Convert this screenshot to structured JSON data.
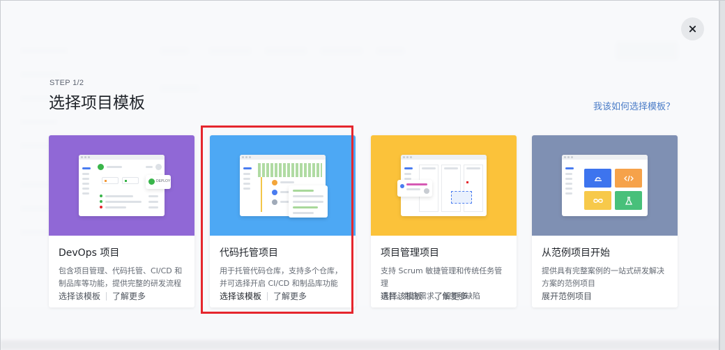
{
  "modal": {
    "step": "STEP 1/2",
    "title": "选择项目模板",
    "help_link": "我该如何选择模板？"
  },
  "colors": {
    "devops": "#9068d6",
    "code": "#4da8f4",
    "pm": "#fbc23a",
    "sample": "#7f90b3",
    "highlight": "#e5262d"
  },
  "cards": [
    {
      "title": "DevOps 项目",
      "desc_line1": "包含项目管理、代码托管、CI/CD 和",
      "desc_line2": "制品库等功能，提供完整的研发流程",
      "action1": "选择该模板",
      "action2": "了解更多",
      "badge": "DEPLOY"
    },
    {
      "title": "代码托管项目",
      "desc_line1": "用于托管代码仓库，支持多个仓库，",
      "desc_line2": "并可选择开启 CI/CD 和制品库功能",
      "action1": "选择该模板",
      "action2": "了解更多"
    },
    {
      "title": "项目管理项目",
      "desc_line1": "支持 Scrum 敏捷管理和传统任务管理",
      "desc_line2": "项目，包含需求、任务和缺陷",
      "action1": "选择该模板",
      "action2": "了解更多"
    },
    {
      "title": "从范例项目开始",
      "desc_line1": "提供具有完整案例的一站式研发解决",
      "desc_line2": "方案的范例项目",
      "action1": "展开范例项目"
    }
  ]
}
